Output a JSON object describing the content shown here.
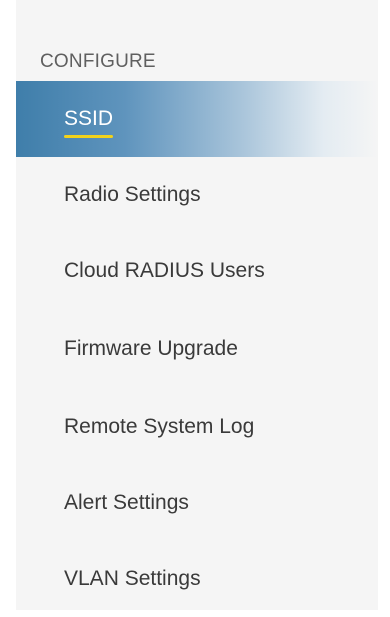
{
  "sidebar": {
    "section_header": "CONFIGURE",
    "items": [
      {
        "label": "SSID",
        "active": true
      },
      {
        "label": "Radio Settings",
        "active": false
      },
      {
        "label": "Cloud RADIUS Users",
        "active": false
      },
      {
        "label": "Firmware Upgrade",
        "active": false
      },
      {
        "label": "Remote System Log",
        "active": false
      },
      {
        "label": "Alert Settings",
        "active": false
      },
      {
        "label": "VLAN Settings",
        "active": false
      }
    ]
  },
  "colors": {
    "active_gradient_start": "#3f7eaa",
    "active_underline": "#f2d21b",
    "panel_background": "#f5f5f5",
    "text": "#3a3a3a"
  }
}
